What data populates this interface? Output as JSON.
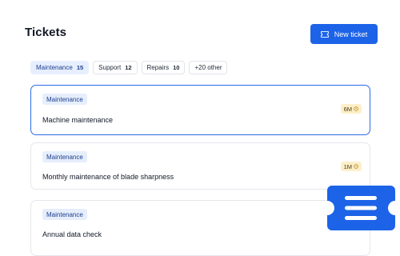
{
  "header": {
    "title": "Tickets",
    "new_ticket_label": "New ticket"
  },
  "filters": [
    {
      "label": "Maintenance",
      "count": "15",
      "active": true
    },
    {
      "label": "Support",
      "count": "12",
      "active": false
    },
    {
      "label": "Repairs",
      "count": "10",
      "active": false
    },
    {
      "label": "+20 other",
      "count": "",
      "active": false
    }
  ],
  "tickets": [
    {
      "tag": "Maintenance",
      "title": "Machine maintenance",
      "age": "6M",
      "selected": true
    },
    {
      "tag": "Maintenance",
      "title": "Monthly maintenance of blade sharpness",
      "age": "1M",
      "selected": false
    },
    {
      "tag": "Maintenance",
      "title": "Annual data check",
      "age": "",
      "selected": false
    }
  ],
  "colors": {
    "accent": "#1c63e8",
    "tag_bg": "#e6eefc",
    "age_badge_bg": "#fdefc8"
  },
  "icons": {
    "new_ticket": "ticket-icon",
    "age": "clock-icon",
    "decor": "ticket-icon"
  }
}
